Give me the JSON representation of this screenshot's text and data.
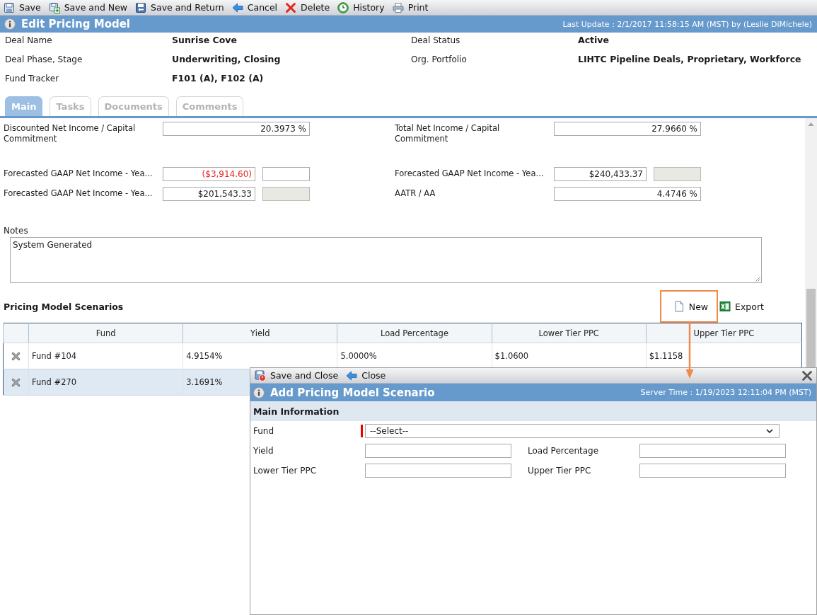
{
  "toolbar": [
    {
      "label": "Save",
      "kind": "save"
    },
    {
      "label": "Save and New",
      "kind": "save-new"
    },
    {
      "label": "Save and Return",
      "kind": "save-return"
    },
    {
      "label": "Cancel",
      "kind": "cancel"
    },
    {
      "label": "Delete",
      "kind": "delete"
    },
    {
      "label": "History",
      "kind": "history"
    },
    {
      "label": "Print",
      "kind": "print"
    }
  ],
  "header": {
    "title": "Edit Pricing Model",
    "last_update": "Last Update : 2/1/2017 11:58:15 AM (MST) by (Leslie DiMichele)"
  },
  "summary": [
    {
      "label": "Deal Name",
      "value": "Sunrise Cove"
    },
    {
      "label": "Deal Status",
      "value": "Active"
    },
    {
      "label": "Deal Phase, Stage",
      "value": "Underwriting, Closing"
    },
    {
      "label": "Org. Portfolio",
      "value": "LIHTC Pipeline Deals, Proprietary, Workforce"
    },
    {
      "label": "Fund Tracker",
      "value": "F101 (A), F102 (A)"
    }
  ],
  "tabs": [
    {
      "label": "Main",
      "selected": true
    },
    {
      "label": "Tasks",
      "selected": false
    },
    {
      "label": "Documents",
      "selected": false
    },
    {
      "label": "Comments",
      "selected": false
    }
  ],
  "metric_groups": [
    {
      "items": [
        {
          "label": "Discounted Net Income / Capital Commitment",
          "value": "20.3973 %",
          "negative": false
        },
        {
          "label": "Total Net Income / Capital Commitment",
          "value": "27.9660 %",
          "negative": false
        }
      ]
    },
    {
      "items": [
        {
          "label": "Forecasted GAAP Net Income - Yea...",
          "value": "($3,914.60)",
          "negative": true,
          "companion": {
            "disabled": false
          }
        },
        {
          "label": "Forecasted GAAP Net Income - Yea...",
          "value": "$240,433.37",
          "negative": false,
          "companion": {
            "disabled": true
          }
        },
        {
          "label": "Forecasted GAAP Net Income - Yea...",
          "value": "$201,543.33",
          "negative": false,
          "companion": {
            "disabled": true
          }
        },
        {
          "label": "AATR / AA",
          "value": "4.4746 %",
          "negative": false
        }
      ]
    }
  ],
  "notes": {
    "label": "Notes",
    "value": "System Generated"
  },
  "scenarios": {
    "title": "Pricing Model Scenarios",
    "actions": [
      {
        "label": "New",
        "kind": "new",
        "highlighted": true
      },
      {
        "label": "Export",
        "kind": "export",
        "highlighted": false
      }
    ],
    "columns": [
      "Fund",
      "Yield",
      "Load Percentage",
      "Lower Tier PPC",
      "Upper Tier PPC"
    ],
    "rows": [
      {
        "cells": [
          "Fund #104",
          "4.9154%",
          "5.0000%",
          "$1.0600",
          "$1.1158"
        ]
      },
      {
        "cells": [
          "Fund #270",
          "3.1691%"
        ]
      }
    ]
  },
  "dialog": {
    "toolbar": [
      {
        "label": "Save and Close",
        "kind": "save-close"
      },
      {
        "label": "Close",
        "kind": "cancel"
      }
    ],
    "title": "Add Pricing Model Scenario",
    "server_time": "Server Time : 1/19/2023 12:11:04 PM (MST)",
    "section": "Main Information",
    "fields": [
      {
        "label": "Fund",
        "kind": "select",
        "required": true,
        "value": "--Select--"
      },
      {
        "label": "Yield",
        "kind": "text",
        "required": false
      },
      {
        "label": "Load Percentage",
        "kind": "text",
        "required": false
      },
      {
        "label": "Lower Tier PPC",
        "kind": "text",
        "required": false
      },
      {
        "label": "Upper Tier PPC",
        "kind": "text",
        "required": false
      }
    ]
  }
}
